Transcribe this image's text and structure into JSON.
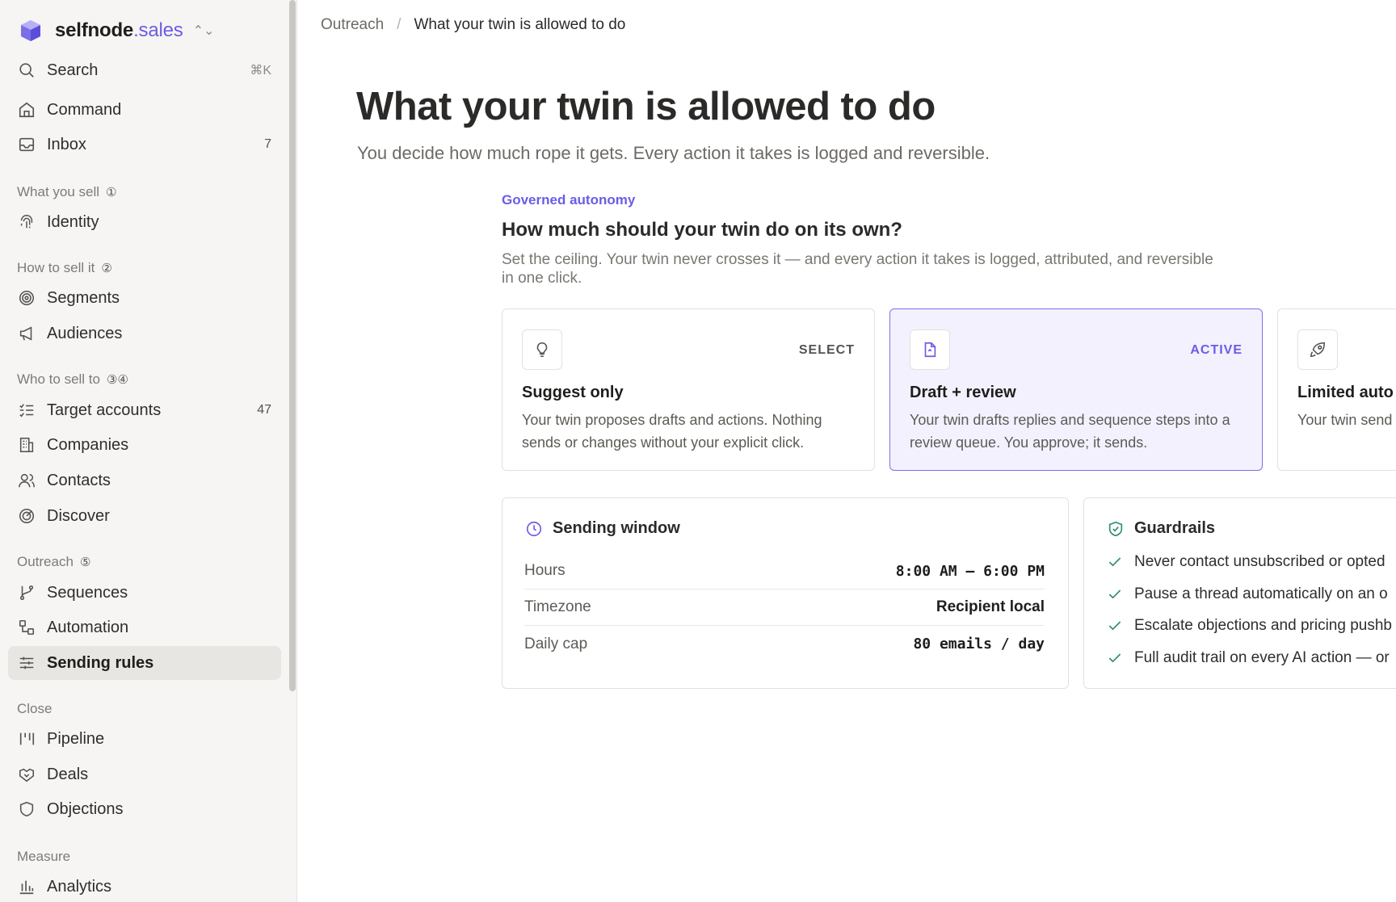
{
  "brand": {
    "name_main": "selfnode",
    "name_accent": ".sales"
  },
  "sidebar": {
    "search": {
      "label": "Search",
      "shortcut": "⌘K"
    },
    "top_items": [
      {
        "label": "Command"
      },
      {
        "label": "Inbox",
        "count": "7"
      }
    ],
    "sections": {
      "what_you_sell": {
        "label": "What you sell",
        "glyph": "①",
        "items": [
          {
            "label": "Identity"
          }
        ]
      },
      "how_to_sell": {
        "label": "How to sell it",
        "glyph": "②",
        "items": [
          {
            "label": "Segments"
          },
          {
            "label": "Audiences"
          }
        ]
      },
      "who_to_sell": {
        "label": "Who to sell to",
        "glyph": "③④",
        "items": [
          {
            "label": "Target accounts",
            "count": "47"
          },
          {
            "label": "Companies"
          },
          {
            "label": "Contacts"
          },
          {
            "label": "Discover"
          }
        ]
      },
      "outreach": {
        "label": "Outreach",
        "glyph": "⑤",
        "items": [
          {
            "label": "Sequences"
          },
          {
            "label": "Automation"
          },
          {
            "label": "Sending rules"
          }
        ]
      },
      "close": {
        "label": "Close",
        "items": [
          {
            "label": "Pipeline"
          },
          {
            "label": "Deals"
          },
          {
            "label": "Objections"
          }
        ]
      },
      "measure": {
        "label": "Measure",
        "items": [
          {
            "label": "Analytics"
          }
        ]
      }
    }
  },
  "breadcrumb": {
    "parent": "Outreach",
    "separator": "/",
    "current": "What your twin is allowed to do"
  },
  "page": {
    "title": "What your twin is allowed to do",
    "subtitle": "You decide how much rope it gets. Every action it takes is logged and reversible."
  },
  "autonomy": {
    "eyebrow": "Governed autonomy",
    "title": "How much should your twin do on its own?",
    "description": "Set the ceiling. Your twin never crosses it — and every action it takes is logged, attributed, and reversible in one click.",
    "modes": [
      {
        "title": "Suggest only",
        "status": "SELECT",
        "description": "Your twin proposes drafts and actions. Nothing sends or changes without your explicit click."
      },
      {
        "title": "Draft + review",
        "status": "ACTIVE",
        "description": "Your twin drafts replies and sequence steps into a review queue. You approve; it sends."
      },
      {
        "title": "Limited auto",
        "status": "",
        "description": "Your twin send — but only insi"
      }
    ]
  },
  "sending_window": {
    "title": "Sending window",
    "rows": [
      {
        "key": "Hours",
        "value": "8:00 AM – 6:00 PM"
      },
      {
        "key": "Timezone",
        "value": "Recipient local"
      },
      {
        "key": "Daily cap",
        "value": "80 emails / day"
      }
    ]
  },
  "guardrails": {
    "title": "Guardrails",
    "items": [
      "Never contact unsubscribed or opted",
      "Pause a thread automatically on an o",
      "Escalate objections and pricing pushb",
      "Full audit trail on every AI action — or"
    ]
  },
  "colors": {
    "accent": "#6b5ce7",
    "check": "#2f8f6b",
    "sidebar_bg": "#f6f5f3"
  }
}
